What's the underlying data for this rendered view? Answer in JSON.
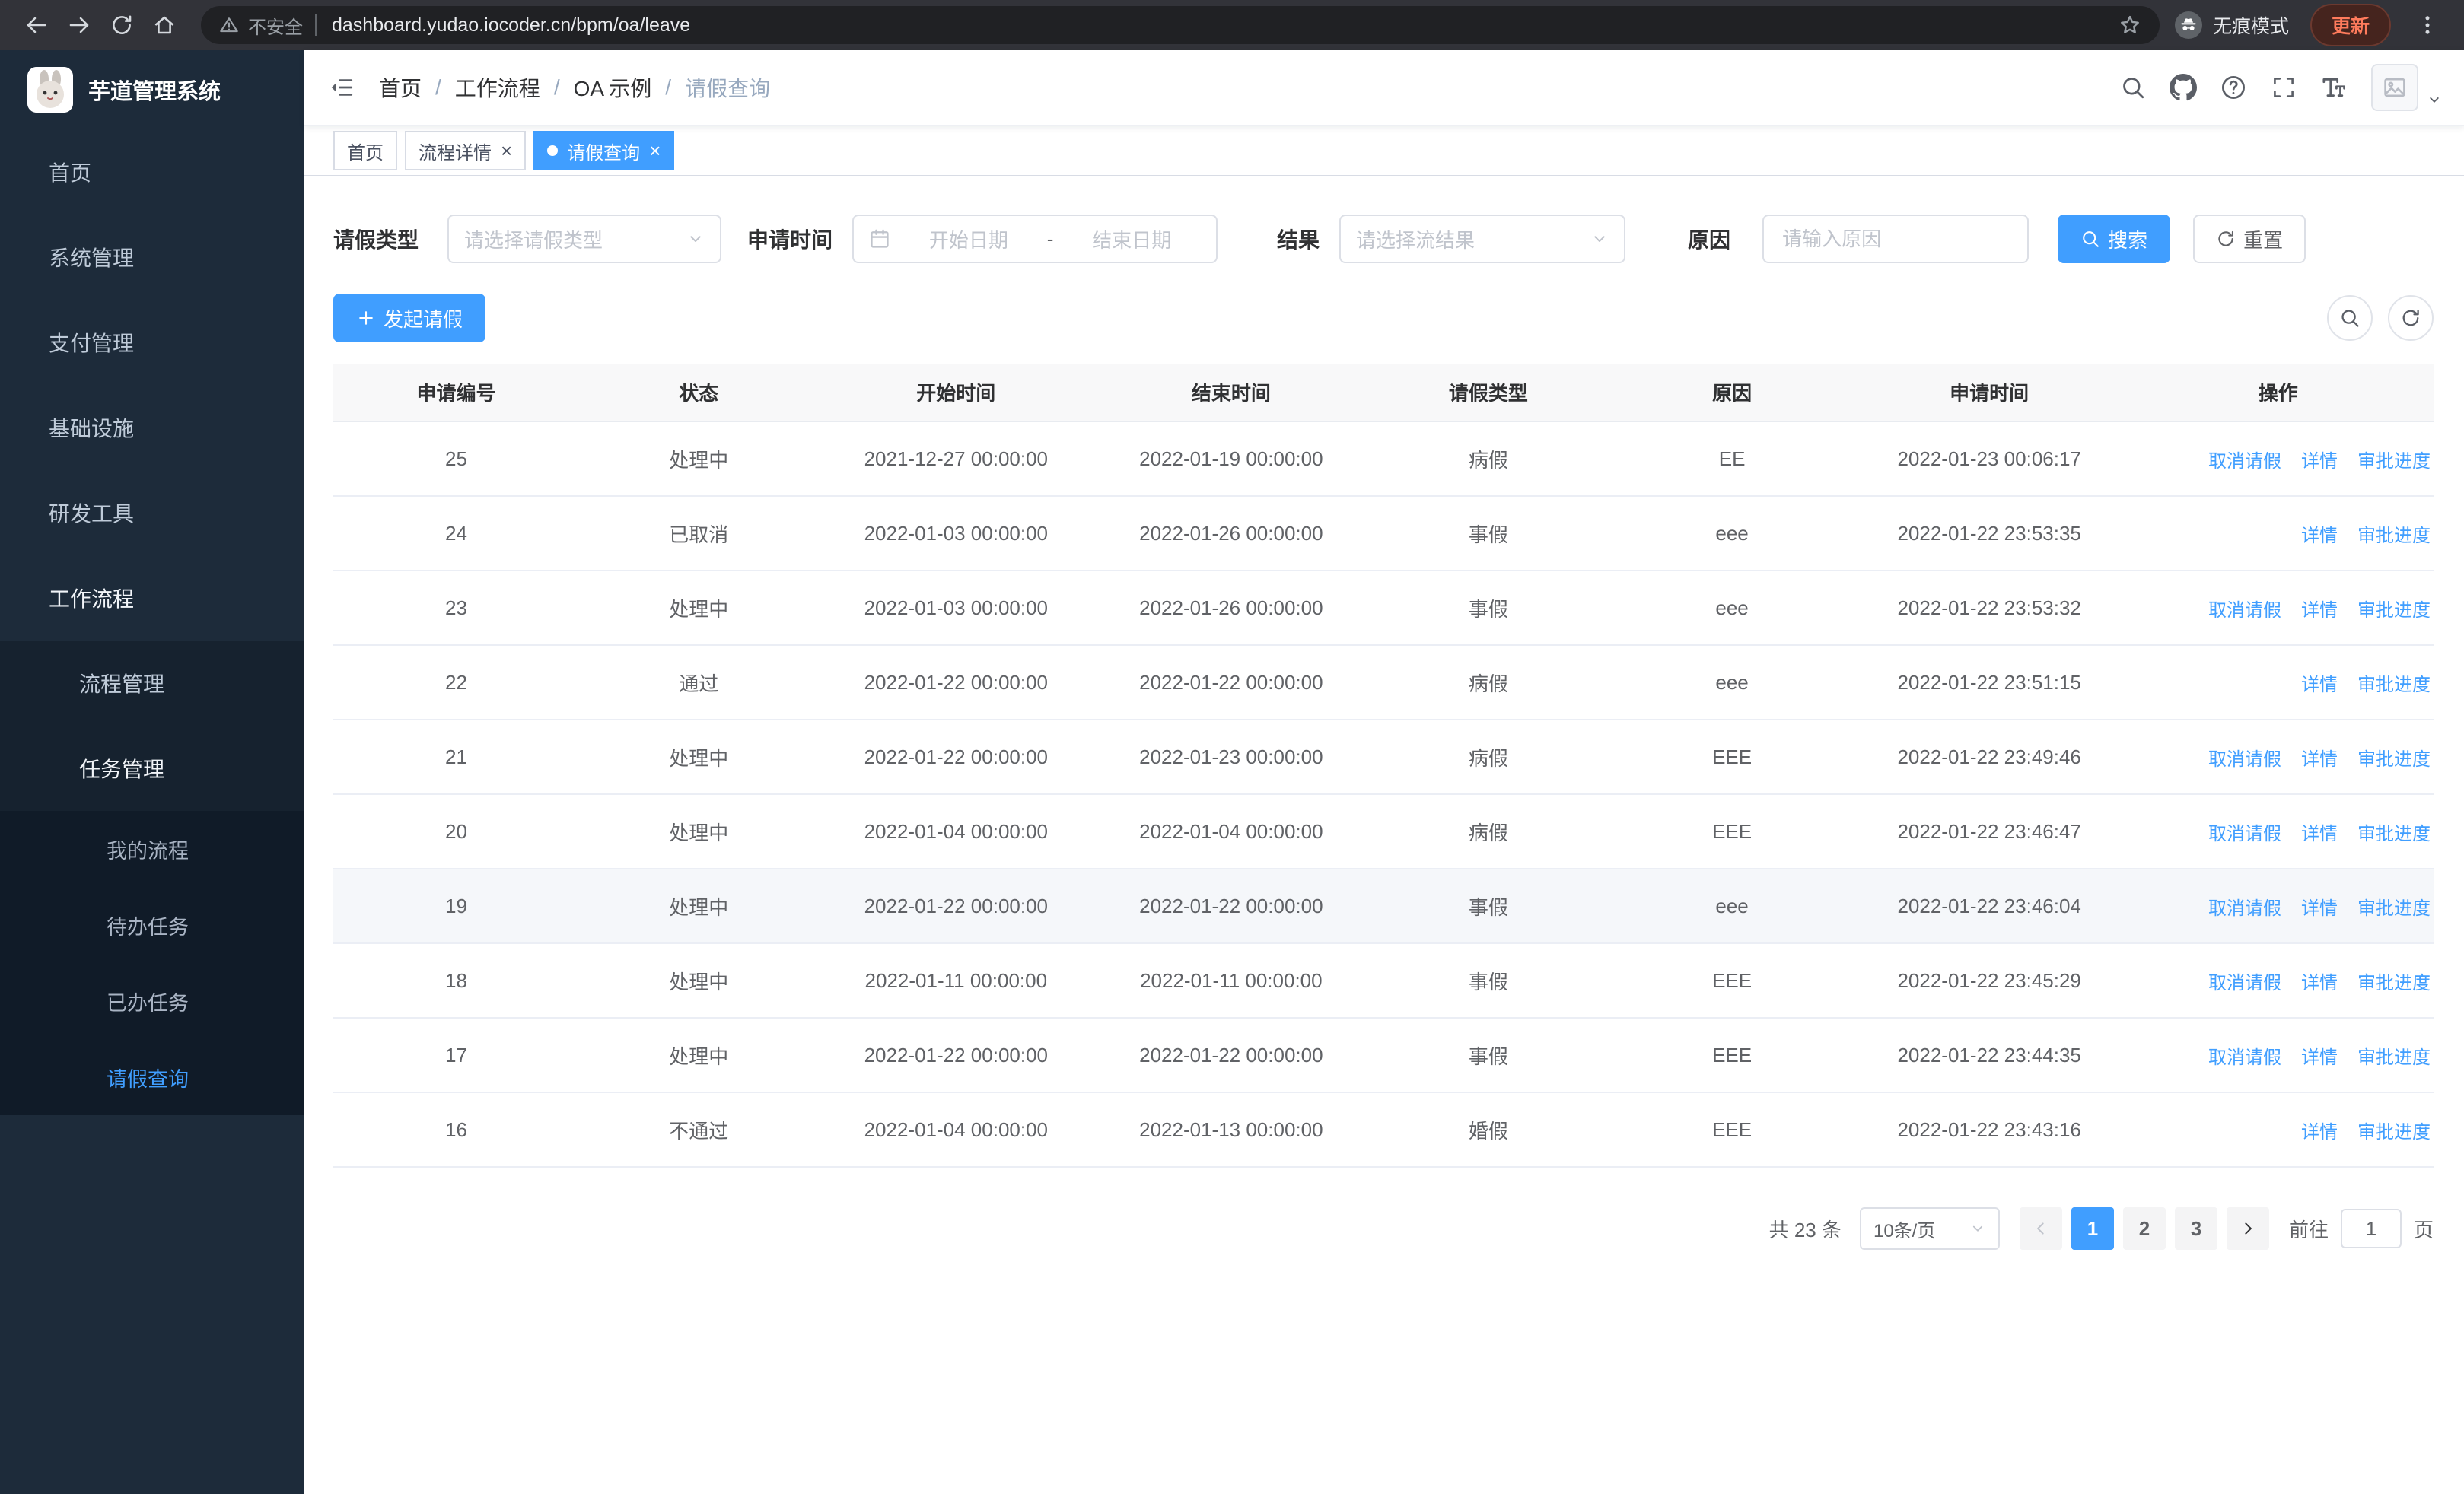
{
  "browser": {
    "security_label": "不安全",
    "url": "dashboard.yudao.iocoder.cn/bpm/oa/leave",
    "incognito_label": "无痕模式",
    "update_label": "更新"
  },
  "app": {
    "title": "芋道管理系统"
  },
  "sidebar": {
    "menu": [
      {
        "label": "首页",
        "icon": "dashboard",
        "level": 1
      },
      {
        "label": "系统管理",
        "icon": "gear",
        "level": 1,
        "chevron": "down"
      },
      {
        "label": "支付管理",
        "icon": "yen",
        "level": 1,
        "chevron": "down"
      },
      {
        "label": "基础设施",
        "icon": "monitor",
        "level": 1,
        "chevron": "down"
      },
      {
        "label": "研发工具",
        "icon": "tools",
        "level": 1,
        "chevron": "down"
      },
      {
        "label": "工作流程",
        "icon": "briefcase",
        "level": 1,
        "chevron": "up",
        "open": true
      },
      {
        "label": "流程管理",
        "icon": "flow",
        "level": 2,
        "chevron": "down"
      },
      {
        "label": "任务管理",
        "icon": "tasks",
        "level": 2,
        "chevron": "up",
        "open": true
      },
      {
        "label": "我的流程",
        "icon": "chat",
        "level": 3
      },
      {
        "label": "待办任务",
        "icon": "eye",
        "level": 3
      },
      {
        "label": "已办任务",
        "icon": "scissors",
        "level": 3
      },
      {
        "label": "请假查询",
        "icon": "user",
        "level": 3,
        "active": true
      }
    ]
  },
  "breadcrumb": [
    "首页",
    "工作流程",
    "OA 示例",
    "请假查询"
  ],
  "tabs": [
    {
      "label": "首页",
      "closable": false,
      "active": false
    },
    {
      "label": "流程详情",
      "closable": true,
      "active": false
    },
    {
      "label": "请假查询",
      "closable": true,
      "active": true
    }
  ],
  "filters": {
    "leave_type_label": "请假类型",
    "leave_type_placeholder": "请选择请假类型",
    "apply_time_label": "申请时间",
    "start_date_placeholder": "开始日期",
    "date_separator": "-",
    "end_date_placeholder": "结束日期",
    "result_label": "结果",
    "result_placeholder": "请选择流结果",
    "reason_label": "原因",
    "reason_placeholder": "请输入原因",
    "search_label": "搜索",
    "reset_label": "重置"
  },
  "toolbar": {
    "create_label": "发起请假"
  },
  "table": {
    "columns": [
      "申请编号",
      "状态",
      "开始时间",
      "结束时间",
      "请假类型",
      "原因",
      "申请时间",
      "操作"
    ],
    "action_labels": {
      "cancel": "取消请假",
      "detail": "详情",
      "progress": "审批进度"
    },
    "rows": [
      {
        "id": "25",
        "status": "处理中",
        "start": "2021-12-27 00:00:00",
        "end": "2022-01-19 00:00:00",
        "type": "病假",
        "reason": "EE",
        "applied": "2022-01-23 00:06:17",
        "actions": [
          "cancel",
          "detail",
          "progress"
        ]
      },
      {
        "id": "24",
        "status": "已取消",
        "start": "2022-01-03 00:00:00",
        "end": "2022-01-26 00:00:00",
        "type": "事假",
        "reason": "eee",
        "applied": "2022-01-22 23:53:35",
        "actions": [
          "detail",
          "progress"
        ]
      },
      {
        "id": "23",
        "status": "处理中",
        "start": "2022-01-03 00:00:00",
        "end": "2022-01-26 00:00:00",
        "type": "事假",
        "reason": "eee",
        "applied": "2022-01-22 23:53:32",
        "actions": [
          "cancel",
          "detail",
          "progress"
        ]
      },
      {
        "id": "22",
        "status": "通过",
        "start": "2022-01-22 00:00:00",
        "end": "2022-01-22 00:00:00",
        "type": "病假",
        "reason": "eee",
        "applied": "2022-01-22 23:51:15",
        "actions": [
          "detail",
          "progress"
        ]
      },
      {
        "id": "21",
        "status": "处理中",
        "start": "2022-01-22 00:00:00",
        "end": "2022-01-23 00:00:00",
        "type": "病假",
        "reason": "EEE",
        "applied": "2022-01-22 23:49:46",
        "actions": [
          "cancel",
          "detail",
          "progress"
        ]
      },
      {
        "id": "20",
        "status": "处理中",
        "start": "2022-01-04 00:00:00",
        "end": "2022-01-04 00:00:00",
        "type": "病假",
        "reason": "EEE",
        "applied": "2022-01-22 23:46:47",
        "actions": [
          "cancel",
          "detail",
          "progress"
        ]
      },
      {
        "id": "19",
        "status": "处理中",
        "start": "2022-01-22 00:00:00",
        "end": "2022-01-22 00:00:00",
        "type": "事假",
        "reason": "eee",
        "applied": "2022-01-22 23:46:04",
        "actions": [
          "cancel",
          "detail",
          "progress"
        ],
        "highlighted": true
      },
      {
        "id": "18",
        "status": "处理中",
        "start": "2022-01-11 00:00:00",
        "end": "2022-01-11 00:00:00",
        "type": "事假",
        "reason": "EEE",
        "applied": "2022-01-22 23:45:29",
        "actions": [
          "cancel",
          "detail",
          "progress"
        ]
      },
      {
        "id": "17",
        "status": "处理中",
        "start": "2022-01-22 00:00:00",
        "end": "2022-01-22 00:00:00",
        "type": "事假",
        "reason": "EEE",
        "applied": "2022-01-22 23:44:35",
        "actions": [
          "cancel",
          "detail",
          "progress"
        ]
      },
      {
        "id": "16",
        "status": "不通过",
        "start": "2022-01-04 00:00:00",
        "end": "2022-01-13 00:00:00",
        "type": "婚假",
        "reason": "EEE",
        "applied": "2022-01-22 23:43:16",
        "actions": [
          "detail",
          "progress"
        ]
      }
    ]
  },
  "pagination": {
    "total_label": "共 23 条",
    "page_size": "10条/页",
    "pages": [
      "1",
      "2",
      "3"
    ],
    "active_page": "1",
    "goto_label": "前往",
    "goto_value": "1",
    "page_label": "页"
  }
}
